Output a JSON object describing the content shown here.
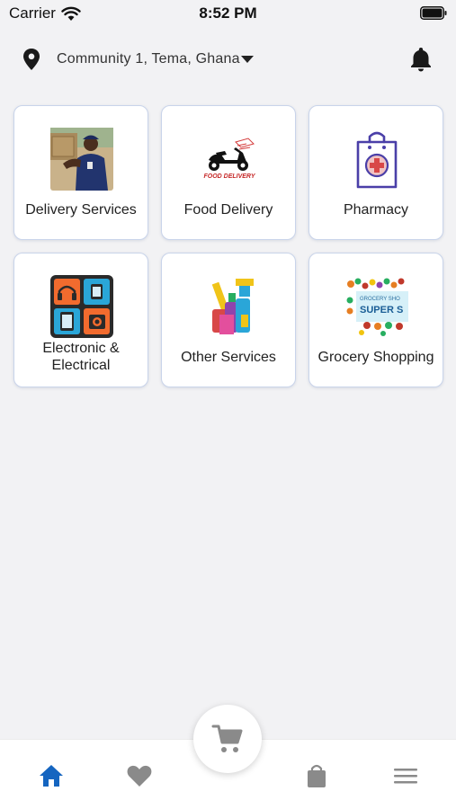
{
  "status_bar": {
    "carrier": "Carrier",
    "time": "8:52 PM"
  },
  "header": {
    "location": "Community 1, Tema, Ghana"
  },
  "services": [
    {
      "label": "Delivery Services",
      "icon": "delivery-person-icon"
    },
    {
      "label": "Food Delivery",
      "icon": "food-delivery-scooter-icon"
    },
    {
      "label": "Pharmacy",
      "icon": "pharmacy-bag-icon"
    },
    {
      "label": "Electronic &\nElectrical",
      "icon": "electronics-icon"
    },
    {
      "label": "Other Services",
      "icon": "cleaning-supplies-icon"
    },
    {
      "label": "Grocery Shopping",
      "icon": "grocery-banner-icon"
    }
  ],
  "food_delivery_logo_text": "FOOD DELIVERY",
  "grocery_banner_text": {
    "top": "GROCERY SHO",
    "main": "SUPER S"
  },
  "tabs": [
    {
      "name": "home",
      "icon": "home-icon",
      "active": true
    },
    {
      "name": "favorites",
      "icon": "heart-icon",
      "active": false
    },
    {
      "name": "cart",
      "icon": "cart-icon",
      "active": false
    },
    {
      "name": "orders",
      "icon": "shopping-bag-icon",
      "active": false
    },
    {
      "name": "menu",
      "icon": "menu-icon",
      "active": false
    }
  ],
  "colors": {
    "active_tab": "#1565c0",
    "inactive_tab": "#8a8a8a",
    "card_border": "#c9d4ea",
    "background": "#f2f2f4",
    "pharmacy_purple": "#4a3fa8"
  }
}
